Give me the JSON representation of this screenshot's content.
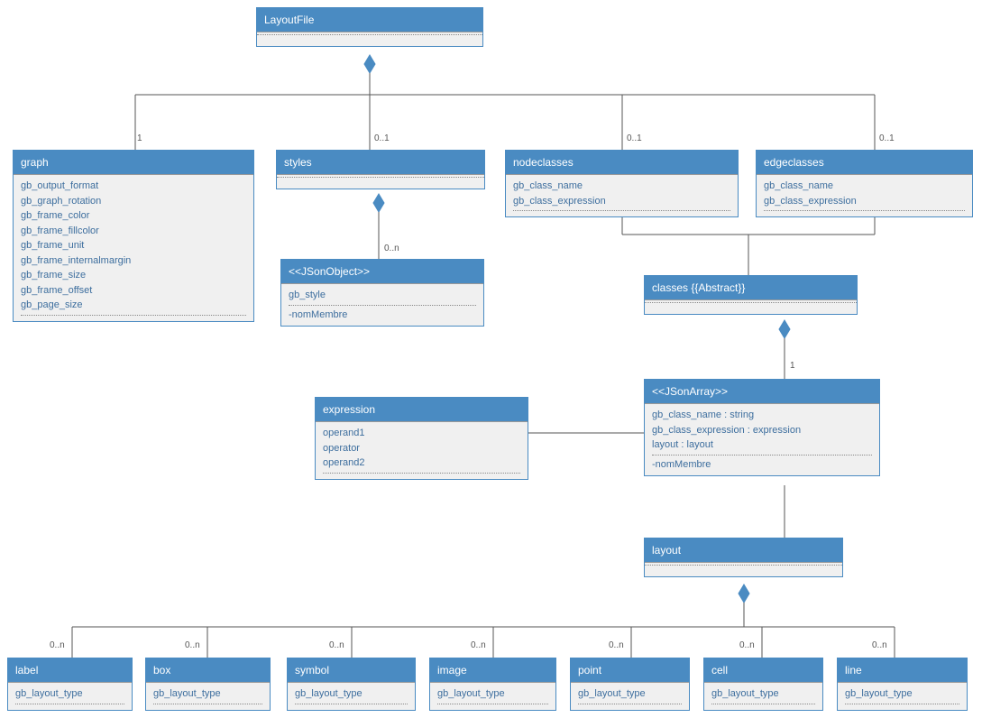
{
  "boxes": {
    "layoutfile": {
      "title": "LayoutFile"
    },
    "graph": {
      "title": "graph",
      "attrs": [
        "gb_output_format",
        "gb_graph_rotation",
        "gb_frame_color",
        "gb_frame_fillcolor",
        "gb_frame_unit",
        "gb_frame_internalmargin",
        "gb_frame_size",
        "gb_frame_offset",
        "gb_page_size"
      ]
    },
    "styles": {
      "title": "styles"
    },
    "nodeclasses": {
      "title": "nodeclasses",
      "attrs": [
        "gb_class_name",
        "gb_class_expression"
      ]
    },
    "edgeclasses": {
      "title": "edgeclasses",
      "attrs": [
        "gb_class_name",
        "gb_class_expression"
      ]
    },
    "jsonobject": {
      "title": "<<JSonObject>>",
      "attrs": [
        "gb_style"
      ],
      "extra": [
        "-nomMembre"
      ]
    },
    "classes": {
      "title": "classes {{Abstract}}"
    },
    "jsonarray": {
      "title": "<<JSonArray>>",
      "attrs": [
        "gb_class_name : string",
        "gb_class_expression : expression",
        "layout : layout"
      ],
      "extra": [
        "-nomMembre"
      ]
    },
    "expression": {
      "title": "expression",
      "attrs": [
        "operand1",
        "operator",
        "operand2"
      ]
    },
    "layout": {
      "title": "layout"
    },
    "label": {
      "title": "label",
      "attrs": [
        "gb_layout_type"
      ]
    },
    "box": {
      "title": "box",
      "attrs": [
        "gb_layout_type"
      ]
    },
    "symbol": {
      "title": "symbol",
      "attrs": [
        "gb_layout_type"
      ]
    },
    "image": {
      "title": "image",
      "attrs": [
        "gb_layout_type"
      ]
    },
    "point": {
      "title": "point",
      "attrs": [
        "gb_layout_type"
      ]
    },
    "cell": {
      "title": "cell",
      "attrs": [
        "gb_layout_type"
      ]
    },
    "line": {
      "title": "line",
      "attrs": [
        "gb_layout_type"
      ]
    }
  },
  "mults": {
    "graph": "1",
    "styles": "0..1",
    "nodeclasses": "0..1",
    "edgeclasses": "0..1",
    "jsonobject": "0..n",
    "jsonarray": "1",
    "label": "0..n",
    "box": "0..n",
    "symbol": "0..n",
    "image": "0..n",
    "point": "0..n",
    "cell": "0..n",
    "line": "0..n"
  }
}
